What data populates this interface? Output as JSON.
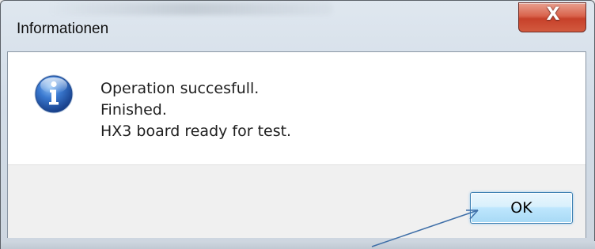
{
  "window": {
    "title": "Informationen",
    "close_icon_glyph": "X"
  },
  "dialog": {
    "icon": "information-icon",
    "message_lines": [
      "Operation succesfull.",
      "Finished.",
      "HX3 board ready for test."
    ],
    "ok_label": "OK"
  },
  "colors": {
    "close_button": "#d9634c",
    "ok_button_border": "#3c7fb1",
    "annotation_arrow": "#3f6fa8",
    "info_icon_blue": "#2f63b8"
  },
  "annotation": {
    "type": "arrow",
    "points_to": "ok-button"
  }
}
